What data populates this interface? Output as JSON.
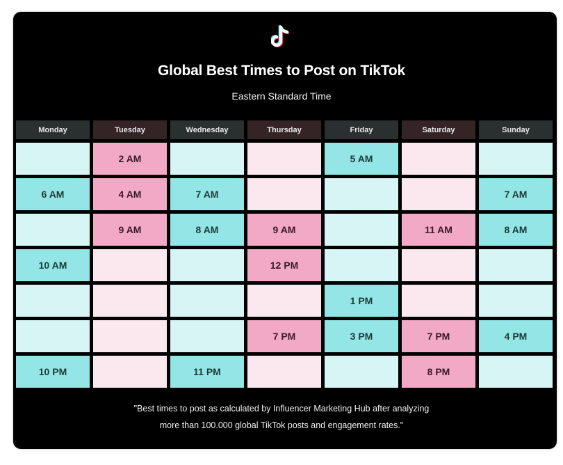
{
  "header": {
    "logo_icon": "tiktok-logo-icon",
    "title": "Global Best Times to Post on TikTok",
    "subtitle": "Eastern Standard Time"
  },
  "colors": {
    "teal_header": "#2a2f2f",
    "pink_header": "#352426",
    "teal_light": "#d8f5f5",
    "teal_highlight": "#94e6e6",
    "pink_light": "#fbe8ee",
    "pink_highlight": "#f1a9c6"
  },
  "chart_data": {
    "type": "table",
    "title": "Global Best Times to Post on TikTok",
    "subtitle": "Eastern Standard Time",
    "columns": [
      {
        "day": "Monday",
        "theme": "teal",
        "slots": [
          "",
          "6 AM",
          "",
          "10 AM",
          "",
          "",
          "10 PM"
        ]
      },
      {
        "day": "Tuesday",
        "theme": "pink",
        "slots": [
          "2 AM",
          "4 AM",
          "9 AM",
          "",
          "",
          "",
          ""
        ]
      },
      {
        "day": "Wednesday",
        "theme": "teal",
        "slots": [
          "",
          "7 AM",
          "8 AM",
          "",
          "",
          "",
          "11 PM"
        ]
      },
      {
        "day": "Thursday",
        "theme": "pink",
        "slots": [
          "",
          "",
          "9 AM",
          "12 PM",
          "",
          "7 PM",
          ""
        ]
      },
      {
        "day": "Friday",
        "theme": "teal",
        "slots": [
          "5 AM",
          "",
          "",
          "",
          "1 PM",
          "3 PM",
          ""
        ]
      },
      {
        "day": "Saturday",
        "theme": "pink",
        "slots": [
          "",
          "",
          "11 AM",
          "",
          "",
          "7 PM",
          "8 PM"
        ]
      },
      {
        "day": "Sunday",
        "theme": "teal",
        "slots": [
          "",
          "7 AM",
          "8 AM",
          "",
          "",
          "4 PM",
          ""
        ]
      }
    ],
    "rows": 7
  },
  "footnote": {
    "line1": "\"Best times to post as calculated by Influencer Marketing Hub after analyzing",
    "line2": "more than 100.000 global TikTok posts and engagement rates.\""
  }
}
